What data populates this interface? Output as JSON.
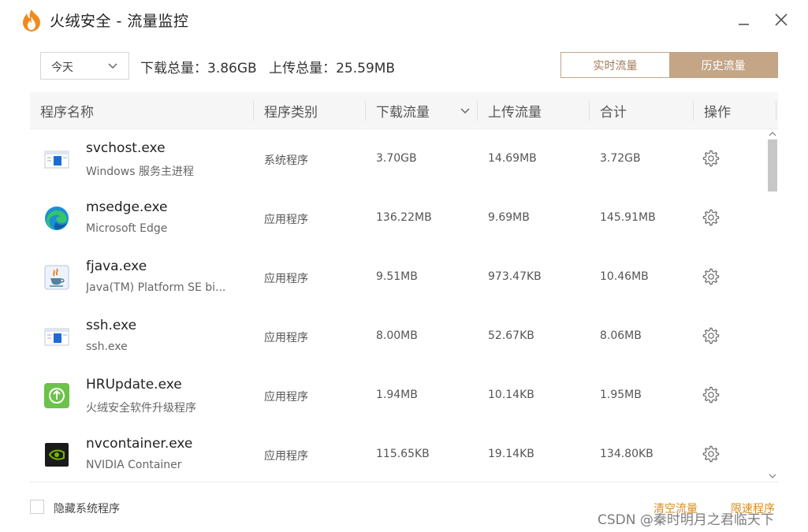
{
  "window": {
    "title": "火绒安全 - 流量监控"
  },
  "toolbar": {
    "date_value": "今天",
    "download_total": "下载总量：3.86GB",
    "upload_total": "上传总量：25.59MB",
    "tabs": [
      "实时流量",
      "历史流量"
    ],
    "active_tab": "历史流量"
  },
  "table": {
    "headers": [
      "程序名称",
      "程序类别",
      "下载流量",
      "上传流量",
      "合计",
      "操作"
    ],
    "rows": [
      {
        "name": "svchost.exe",
        "desc": "Windows 服务主进程",
        "type": "系统程序",
        "download": "3.70GB",
        "upload": "14.69MB",
        "total": "3.72GB",
        "icon": "windows-app-icon"
      },
      {
        "name": "msedge.exe",
        "desc": "Microsoft Edge",
        "type": "应用程序",
        "download": "136.22MB",
        "upload": "9.69MB",
        "total": "145.91MB",
        "icon": "edge-icon"
      },
      {
        "name": "fjava.exe",
        "desc": "Java(TM) Platform SE bi...",
        "type": "应用程序",
        "download": "9.51MB",
        "upload": "973.47KB",
        "total": "10.46MB",
        "icon": "java-icon"
      },
      {
        "name": "ssh.exe",
        "desc": "ssh.exe",
        "type": "应用程序",
        "download": "8.00MB",
        "upload": "52.67KB",
        "total": "8.06MB",
        "icon": "windows-app-icon"
      },
      {
        "name": "HRUpdate.exe",
        "desc": "火绒安全软件升级程序",
        "type": "应用程序",
        "download": "1.94MB",
        "upload": "10.14KB",
        "total": "1.95MB",
        "icon": "hr-update-icon"
      },
      {
        "name": "nvcontainer.exe",
        "desc": "NVIDIA Container",
        "type": "应用程序",
        "download": "115.65KB",
        "upload": "19.14KB",
        "total": "134.80KB",
        "icon": "nvidia-icon"
      }
    ]
  },
  "footer": {
    "hide_system_label": "隐藏系统程序",
    "hide_system_checked": false,
    "clear_label": "清空流量",
    "limit_label": "限速程序",
    "watermark": "CSDN @秦时明月之君临天下"
  },
  "colors": {
    "accent": "#c4a586",
    "link": "#d98c1a",
    "logo": "#f08a1c"
  }
}
